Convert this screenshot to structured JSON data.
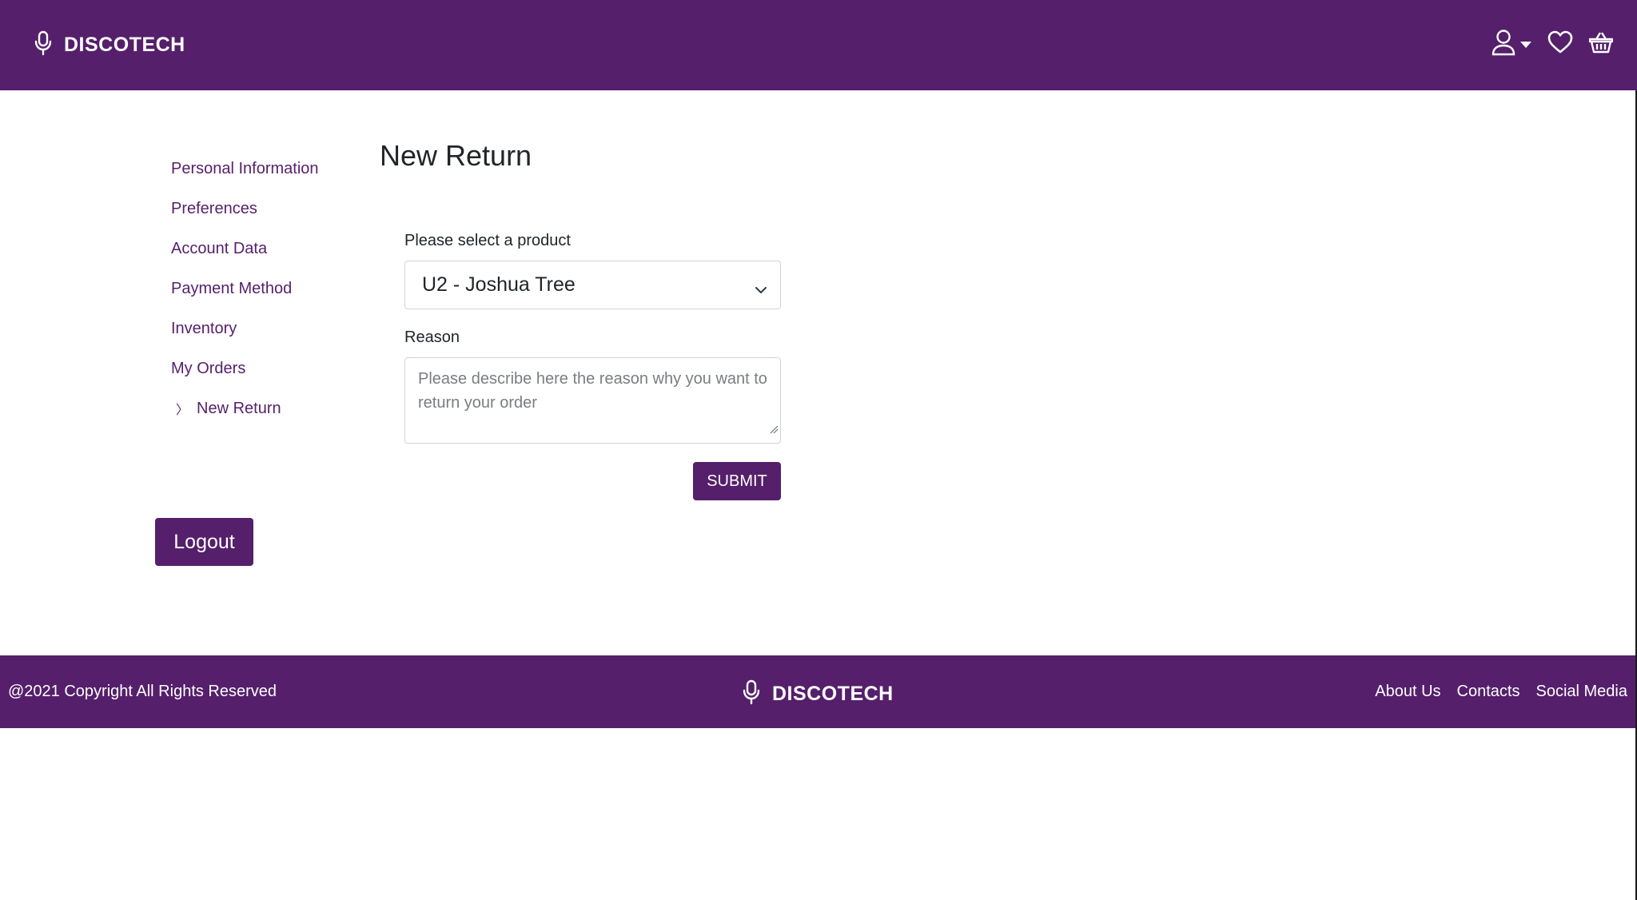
{
  "header": {
    "brand": "DISCOTECH",
    "icons": [
      "microphone-icon",
      "user-icon",
      "caret-down-icon",
      "heart-icon",
      "basket-icon"
    ]
  },
  "sidebar": {
    "items": [
      {
        "label": "Personal Information",
        "active": false
      },
      {
        "label": "Preferences",
        "active": false
      },
      {
        "label": "Account Data",
        "active": false
      },
      {
        "label": "Payment Method",
        "active": false
      },
      {
        "label": "Inventory",
        "active": false
      },
      {
        "label": "My Orders",
        "active": false
      },
      {
        "label": "New Return",
        "active": true,
        "marker": "〉"
      }
    ],
    "logout_label": "Logout"
  },
  "main": {
    "title": "New Return",
    "product_label": "Please select a product",
    "product_selected": "U2 - Joshua Tree",
    "reason_label": "Reason",
    "reason_placeholder": "Please describe here the reason why you want to return your order",
    "submit_label": "SUBMIT"
  },
  "footer": {
    "copyright": "@2021 Copyright All Rights Reserved",
    "brand": "DISCOTECH",
    "links": [
      "About Us",
      "Contacts",
      "Social Media"
    ]
  },
  "colors": {
    "brand_purple": "#551f6b",
    "text_dark": "#212529",
    "border": "#ced4da",
    "placeholder": "#7a7d81"
  }
}
